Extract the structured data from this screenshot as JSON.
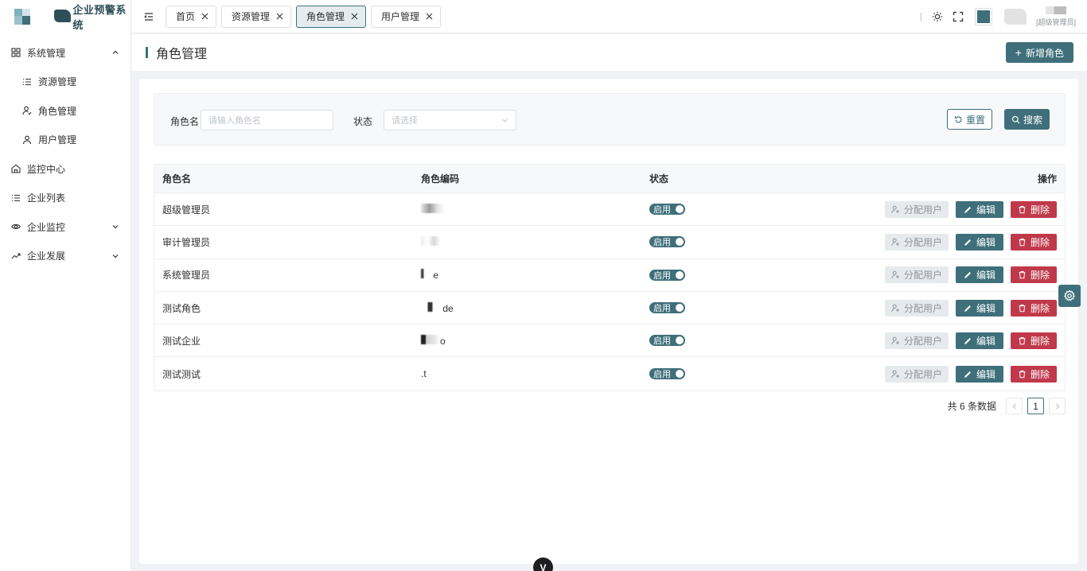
{
  "app": {
    "title": "企业预警系统",
    "brand_color": "#3f6f7a"
  },
  "sidebar": {
    "items": [
      {
        "label": "系统管理",
        "icon": "grid-icon",
        "expanded": true
      },
      {
        "label": "资源管理",
        "icon": "list-icon",
        "sub": true
      },
      {
        "label": "角色管理",
        "icon": "user-check-icon",
        "sub": true
      },
      {
        "label": "用户管理",
        "icon": "user-icon",
        "sub": true
      },
      {
        "label": "监控中心",
        "icon": "home-icon"
      },
      {
        "label": "企业列表",
        "icon": "list-icon"
      },
      {
        "label": "企业监控",
        "icon": "eye-icon",
        "expanded": false
      },
      {
        "label": "企业发展",
        "icon": "trend-icon",
        "expanded": false
      }
    ]
  },
  "tabs": [
    {
      "label": "首页"
    },
    {
      "label": "资源管理"
    },
    {
      "label": "角色管理",
      "active": true
    },
    {
      "label": "用户管理"
    }
  ],
  "user": {
    "role": "[超级管理员]"
  },
  "page": {
    "title": "角色管理",
    "add_button": "新增角色"
  },
  "search": {
    "role_name_label": "角色名",
    "role_name_placeholder": "请输入角色名",
    "status_label": "状态",
    "status_placeholder": "请选择",
    "reset_label": "重置",
    "search_label": "搜索"
  },
  "table": {
    "headers": [
      "角色名",
      "角色编码",
      "状态",
      "操作"
    ],
    "rows": [
      {
        "name": "超级管理员",
        "status": "启用"
      },
      {
        "name": "审计管理员",
        "status": "启用"
      },
      {
        "name": "系统管理员",
        "code_tail": "e",
        "status": "启用"
      },
      {
        "name": "测试角色",
        "code_tail": "de",
        "status": "启用"
      },
      {
        "name": "测试企业",
        "code_tail": "o",
        "status": "启用"
      },
      {
        "name": "测试测试",
        "code_tail": ".t",
        "status": "启用"
      }
    ],
    "actions": {
      "assign": "分配用户",
      "edit": "编辑",
      "delete": "删除"
    }
  },
  "pagination": {
    "total_text": "共 6 条数据",
    "current_page": "1"
  },
  "bottom_badge": "V"
}
